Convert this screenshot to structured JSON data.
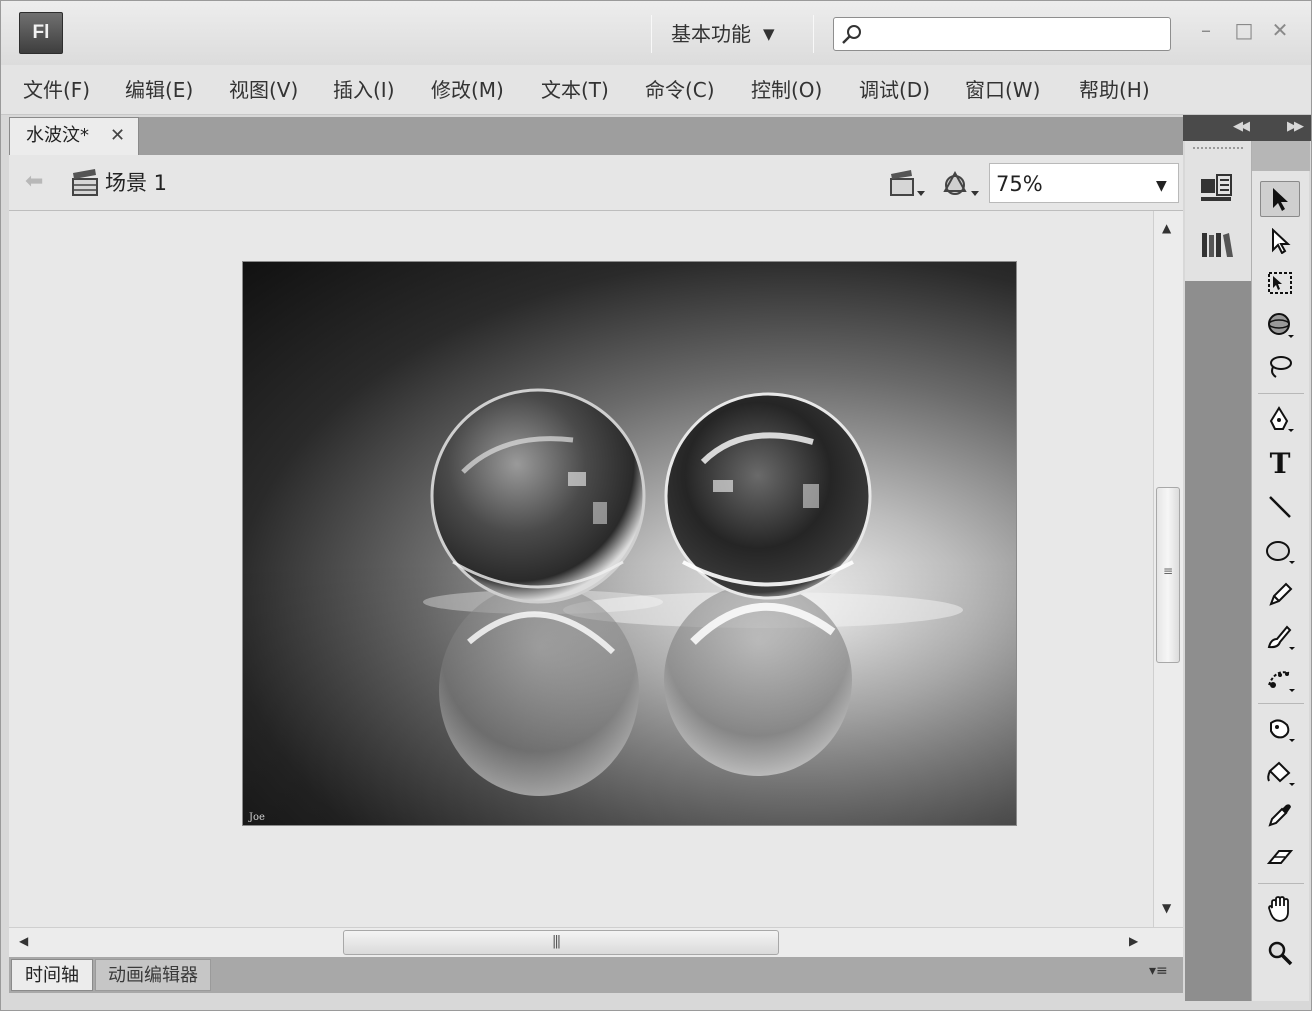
{
  "app": {
    "logo_text": "Fl",
    "workspace_label": "基本功能",
    "search_placeholder": ""
  },
  "window_controls": {
    "minimize": "–",
    "maximize": "□",
    "close": "✕"
  },
  "menu": [
    "文件(F)",
    "编辑(E)",
    "视图(V)",
    "插入(I)",
    "修改(M)",
    "文本(T)",
    "命令(C)",
    "控制(O)",
    "调试(D)",
    "窗口(W)",
    "帮助(H)"
  ],
  "document_tab": {
    "title": "水波汶*",
    "close": "✕"
  },
  "edit_bar": {
    "scene_label": "场景 1",
    "zoom": "75%"
  },
  "bottom_tabs": [
    "时间轴",
    "动画编辑器"
  ],
  "stage": {
    "content": "two glass spheres on reflective surface",
    "signature": "Joe"
  },
  "tools": [
    "selection-tool",
    "subselection-tool",
    "free-transform-tool",
    "3d-rotation-tool",
    "lasso-tool",
    "pen-tool",
    "text-tool",
    "line-tool",
    "oval-tool",
    "pencil-tool",
    "brush-tool",
    "deco-tool",
    "bone-tool",
    "paint-bucket-tool",
    "eyedropper-tool",
    "eraser-tool",
    "hand-tool",
    "zoom-tool"
  ],
  "text_tool_glyph": "T",
  "colors": {
    "chrome": "#d8d8d8",
    "dark_panel": "#4a4a4a",
    "stage_bg": "#e8e8e8"
  }
}
